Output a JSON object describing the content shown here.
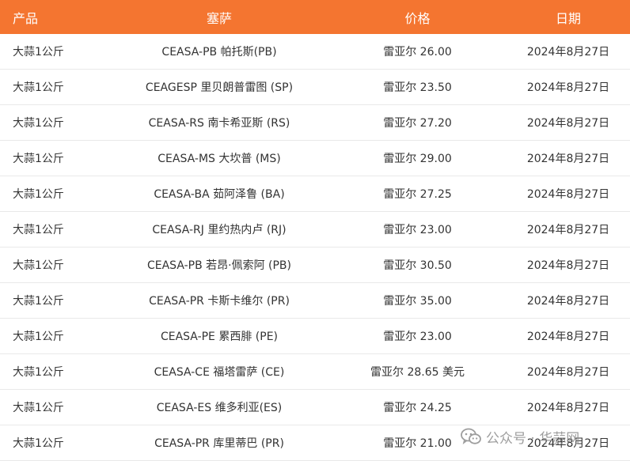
{
  "table": {
    "headers": [
      "产品",
      "塞萨",
      "价格",
      "日期"
    ],
    "rows": [
      {
        "product": "大蒜1公斤",
        "market": "CEASA-PB 帕托斯(PB)",
        "price": "雷亚尔 26.00",
        "date": "2024年8月27日"
      },
      {
        "product": "大蒜1公斤",
        "market": "CEAGESP 里贝朗普雷图 (SP)",
        "price": "雷亚尔 23.50",
        "date": "2024年8月27日"
      },
      {
        "product": "大蒜1公斤",
        "market": "CEASA-RS 南卡希亚斯 (RS)",
        "price": "雷亚尔 27.20",
        "date": "2024年8月27日"
      },
      {
        "product": "大蒜1公斤",
        "market": "CEASA-MS 大坎普 (MS)",
        "price": "雷亚尔 29.00",
        "date": "2024年8月27日"
      },
      {
        "product": "大蒜1公斤",
        "market": "CEASA-BA 茹阿泽鲁 (BA)",
        "price": "雷亚尔 27.25",
        "date": "2024年8月27日"
      },
      {
        "product": "大蒜1公斤",
        "market": "CEASA-RJ 里约热内卢 (RJ)",
        "price": "雷亚尔 23.00",
        "date": "2024年8月27日"
      },
      {
        "product": "大蒜1公斤",
        "market": "CEASA-PB 若昂·佩索阿 (PB)",
        "price": "雷亚尔 30.50",
        "date": "2024年8月27日"
      },
      {
        "product": "大蒜1公斤",
        "market": "CEASA-PR 卡斯卡维尔 (PR)",
        "price": "雷亚尔 35.00",
        "date": "2024年8月27日"
      },
      {
        "product": "大蒜1公斤",
        "market": "CEASA-PE 累西腓 (PE)",
        "price": "雷亚尔 23.00",
        "date": "2024年8月27日"
      },
      {
        "product": "大蒜1公斤",
        "market": "CEASA-CE 福塔雷萨 (CE)",
        "price": "雷亚尔 28.65 美元",
        "date": "2024年8月27日"
      },
      {
        "product": "大蒜1公斤",
        "market": "CEASA-ES 维多利亚(ES)",
        "price": "雷亚尔 24.25",
        "date": "2024年8月27日"
      },
      {
        "product": "大蒜1公斤",
        "market": "CEASA-PR 库里蒂巴 (PR)",
        "price": "雷亚尔 21.00",
        "date": "2024年8月27日"
      }
    ]
  },
  "watermark": {
    "icon": "wechat-icon",
    "text": "公众号 · 华蒜网"
  },
  "colors": {
    "header_bg": "#f47530",
    "header_text": "#ffffff",
    "row_text": "#333333",
    "row_divider": "#e9e9e9"
  }
}
